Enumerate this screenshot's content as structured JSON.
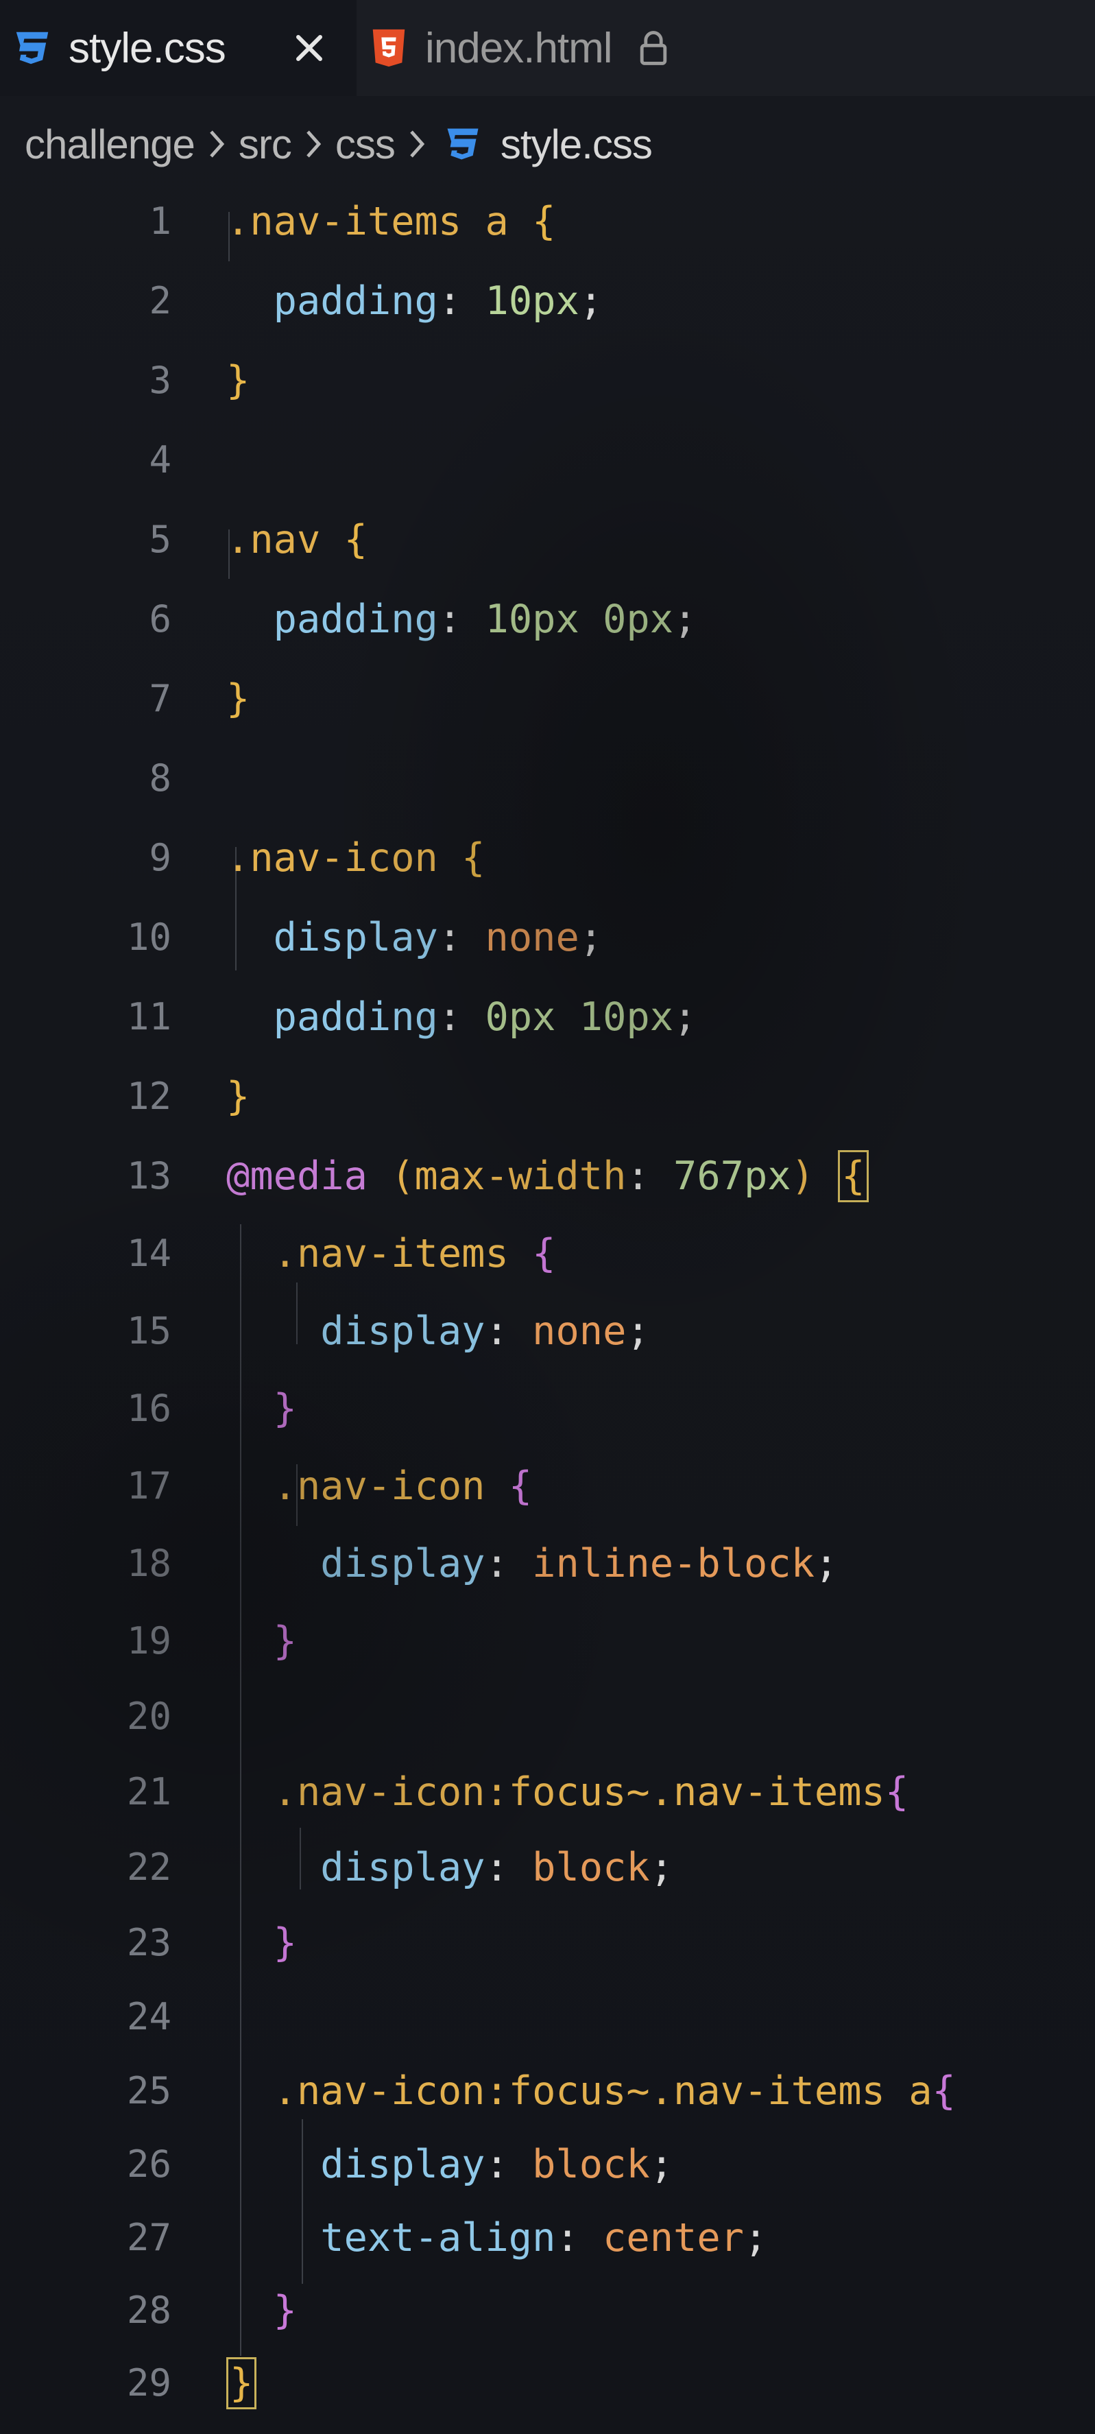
{
  "tabs": [
    {
      "label": "style.css",
      "icon": "css3-file-icon",
      "active": true,
      "closable": true
    },
    {
      "label": "index.html",
      "icon": "html5-file-icon",
      "active": false,
      "locked": true
    }
  ],
  "breadcrumb": [
    "challenge",
    "src",
    "css",
    "style.css"
  ],
  "colors": {
    "selector": "#e2b04e",
    "property": "#8fc8e8",
    "number": "#b8d49a",
    "keyword": "#e59a5a",
    "at_rule": "#c77dd6",
    "bracket_outer": "#e7b649",
    "bracket_inner": "#c878d8",
    "css_icon": "#3b8eea",
    "html_icon": "#e44d26"
  },
  "code_lines": [
    {
      "n": "1",
      "parts": [
        [
          "sel",
          ".nav-items a "
        ],
        [
          "br1",
          "{"
        ]
      ]
    },
    {
      "n": "2",
      "parts": [
        [
          "prop",
          "  padding"
        ],
        [
          "punc",
          ": "
        ],
        [
          "num",
          "10px"
        ],
        [
          "punc",
          ";"
        ]
      ]
    },
    {
      "n": "3",
      "parts": [
        [
          "br1",
          "}"
        ]
      ]
    },
    {
      "n": "4",
      "parts": []
    },
    {
      "n": "5",
      "parts": [
        [
          "sel",
          ".nav "
        ],
        [
          "br1",
          "{"
        ]
      ]
    },
    {
      "n": "6",
      "parts": [
        [
          "prop",
          "  padding"
        ],
        [
          "punc",
          ": "
        ],
        [
          "num",
          "10px 0px"
        ],
        [
          "punc",
          ";"
        ]
      ]
    },
    {
      "n": "7",
      "parts": [
        [
          "br1",
          "}"
        ]
      ]
    },
    {
      "n": "8",
      "parts": []
    },
    {
      "n": "9",
      "parts": [
        [
          "sel",
          ".nav-icon "
        ],
        [
          "br1",
          "{"
        ]
      ]
    },
    {
      "n": "10",
      "parts": [
        [
          "prop",
          "  display"
        ],
        [
          "punc",
          ": "
        ],
        [
          "kw",
          "none"
        ],
        [
          "punc",
          ";"
        ]
      ]
    },
    {
      "n": "11",
      "parts": [
        [
          "prop",
          "  padding"
        ],
        [
          "punc",
          ": "
        ],
        [
          "num",
          "0px 10px"
        ],
        [
          "punc",
          ";"
        ]
      ]
    },
    {
      "n": "12",
      "parts": [
        [
          "br1",
          "}"
        ]
      ]
    },
    {
      "n": "13",
      "parts": [
        [
          "at",
          "@media "
        ],
        [
          "sel",
          "(max-width"
        ],
        [
          "punc",
          ": "
        ],
        [
          "num",
          "767px"
        ],
        [
          "sel",
          ") "
        ],
        [
          "box",
          "{"
        ]
      ]
    },
    {
      "n": "14",
      "parts": [
        [
          "sel",
          "  .nav-items "
        ],
        [
          "br2",
          "{"
        ]
      ]
    },
    {
      "n": "15",
      "parts": [
        [
          "prop",
          "    display"
        ],
        [
          "punc",
          ": "
        ],
        [
          "kw",
          "none"
        ],
        [
          "punc",
          ";"
        ]
      ]
    },
    {
      "n": "16",
      "parts": [
        [
          "br2",
          "  }"
        ]
      ]
    },
    {
      "n": "17",
      "parts": [
        [
          "sel",
          "  .nav-icon "
        ],
        [
          "br2",
          "{"
        ]
      ]
    },
    {
      "n": "18",
      "parts": [
        [
          "prop",
          "    display"
        ],
        [
          "punc",
          ": "
        ],
        [
          "kw",
          "inline-block"
        ],
        [
          "punc",
          ";"
        ]
      ]
    },
    {
      "n": "19",
      "parts": [
        [
          "br2",
          "  }"
        ]
      ]
    },
    {
      "n": "20",
      "parts": []
    },
    {
      "n": "21",
      "parts": [
        [
          "sel",
          "  .nav-icon:focus~.nav-items"
        ],
        [
          "br2",
          "{"
        ]
      ]
    },
    {
      "n": "22",
      "parts": [
        [
          "prop",
          "    display"
        ],
        [
          "punc",
          ": "
        ],
        [
          "kw",
          "block"
        ],
        [
          "punc",
          ";"
        ]
      ]
    },
    {
      "n": "23",
      "parts": [
        [
          "br2",
          "  }"
        ]
      ]
    },
    {
      "n": "24",
      "parts": []
    },
    {
      "n": "25",
      "parts": [
        [
          "sel",
          "  .nav-icon:focus~.nav-items a"
        ],
        [
          "br2",
          "{"
        ]
      ]
    },
    {
      "n": "26",
      "parts": [
        [
          "prop",
          "    display"
        ],
        [
          "punc",
          ": "
        ],
        [
          "kw",
          "block"
        ],
        [
          "punc",
          ";"
        ]
      ]
    },
    {
      "n": "27",
      "parts": [
        [
          "prop",
          "    text-align"
        ],
        [
          "punc",
          ": "
        ],
        [
          "kw",
          "center"
        ],
        [
          "punc",
          ";"
        ]
      ]
    },
    {
      "n": "28",
      "parts": [
        [
          "br2",
          "  }"
        ]
      ]
    },
    {
      "n": "29",
      "parts": [
        [
          "box",
          "}"
        ]
      ]
    }
  ]
}
